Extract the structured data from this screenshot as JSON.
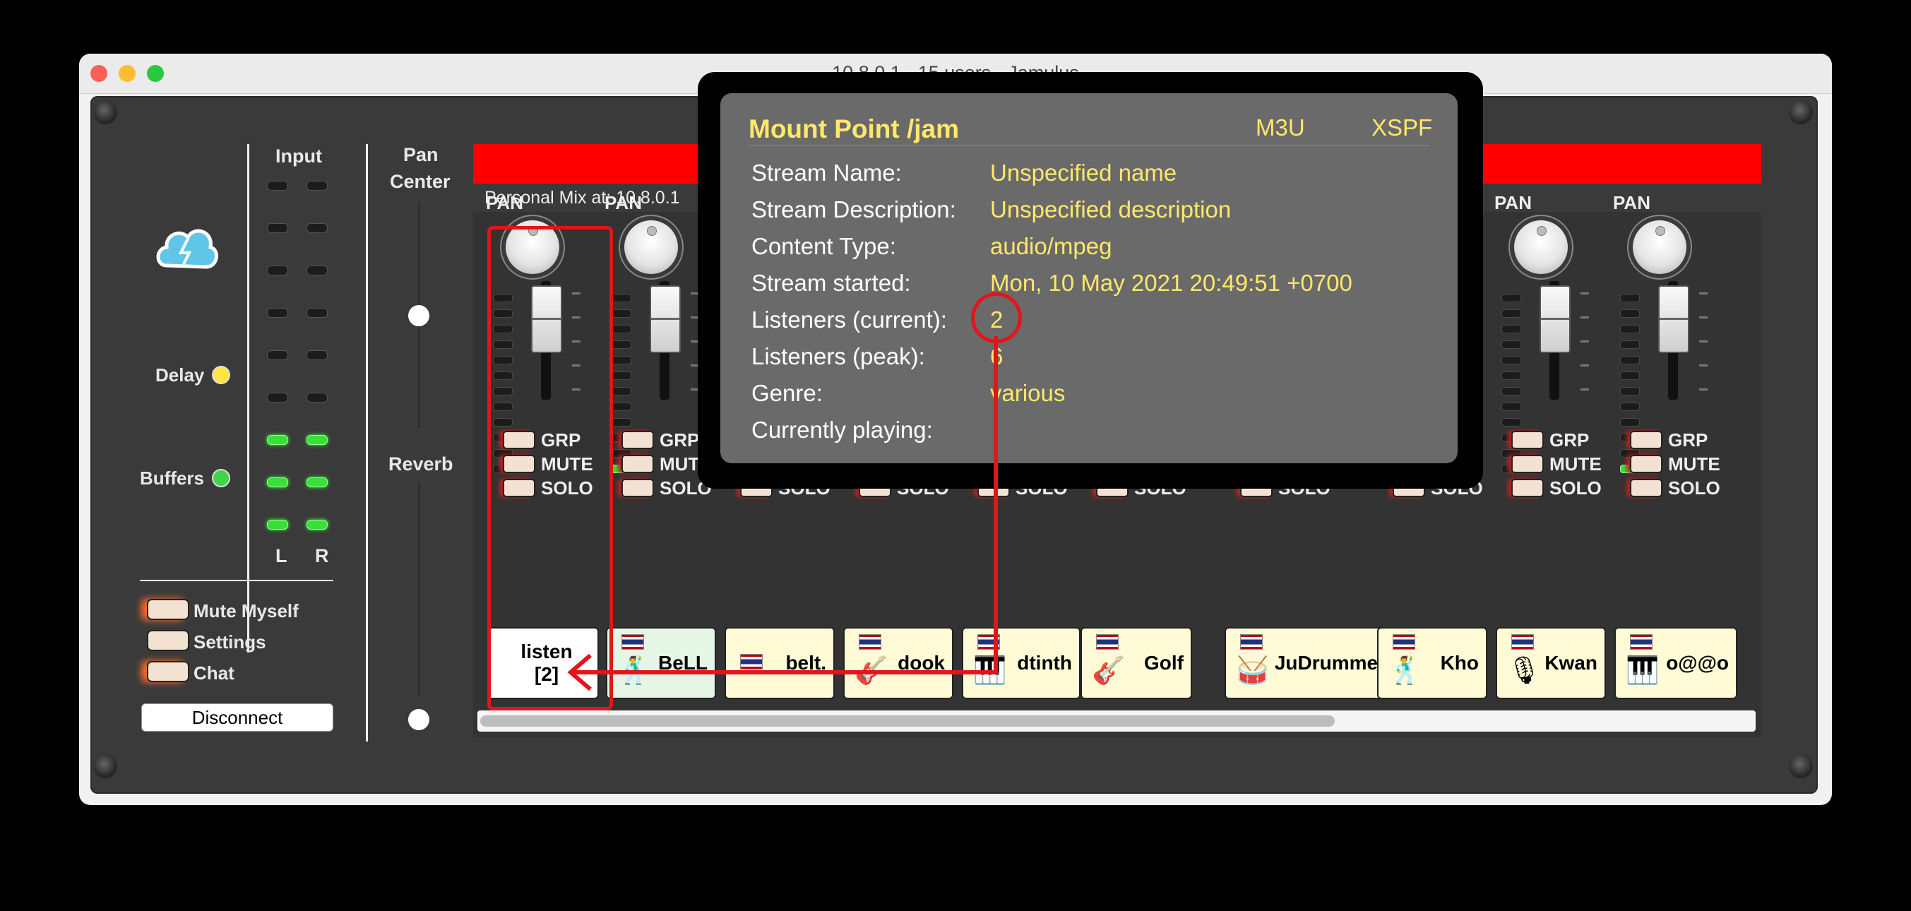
{
  "window": {
    "title": "10.8.0.1 - 15 users - Jamulus"
  },
  "left": {
    "input_label": "Input",
    "meter_l": "L",
    "meter_r": "R",
    "delay_label": "Delay",
    "buffers_label": "Buffers",
    "mute_myself_label": "Mute Myself",
    "settings_label": "Settings",
    "chat_label": "Chat",
    "disconnect_label": "Disconnect",
    "pan_label": "Pan",
    "center_label": "Center",
    "reverb_label": "Reverb"
  },
  "mixer": {
    "personal_mix": "Personal Mix at: 10.8.0.1",
    "pan_label": "PAN",
    "grp_label": "GRP",
    "mute_label": "MUTE",
    "solo_label": "SOLO",
    "channels": [
      {
        "name": "listen [2]",
        "instrument": ""
      },
      {
        "name": "BeLL",
        "instrument": "singer"
      },
      {
        "name": "belt.",
        "instrument": ""
      },
      {
        "name": "dook",
        "instrument": "guitar"
      },
      {
        "name": "dtinth",
        "instrument": "keyboard"
      },
      {
        "name": "Golf",
        "instrument": "electric-guitar"
      },
      {
        "name": "JuDrummer",
        "instrument": "drums"
      },
      {
        "name": "Kho",
        "instrument": "singer"
      },
      {
        "name": "Kwan",
        "instrument": "microphone"
      },
      {
        "name": "o@@o",
        "instrument": "keyboard"
      }
    ]
  },
  "popup": {
    "title": "Mount Point /jam",
    "link_m3u": "M3U",
    "link_xspf": "XSPF",
    "rows": [
      {
        "key": "Stream Name:",
        "value": "Unspecified name"
      },
      {
        "key": "Stream Description:",
        "value": "Unspecified description"
      },
      {
        "key": "Content Type:",
        "value": "audio/mpeg"
      },
      {
        "key": "Stream started:",
        "value": "Mon, 10 May 2021 20:49:51 +0700"
      },
      {
        "key": "Listeners (current):",
        "value": "2"
      },
      {
        "key": "Listeners (peak):",
        "value": "6"
      },
      {
        "key": "Genre:",
        "value": "various"
      },
      {
        "key": "Currently playing:",
        "value": ""
      }
    ]
  },
  "colors": {
    "accent_yellow": "#ffe86b",
    "annotation_red": "#e3141c",
    "led_green": "#38e038",
    "panel": "#3a3a3a"
  }
}
